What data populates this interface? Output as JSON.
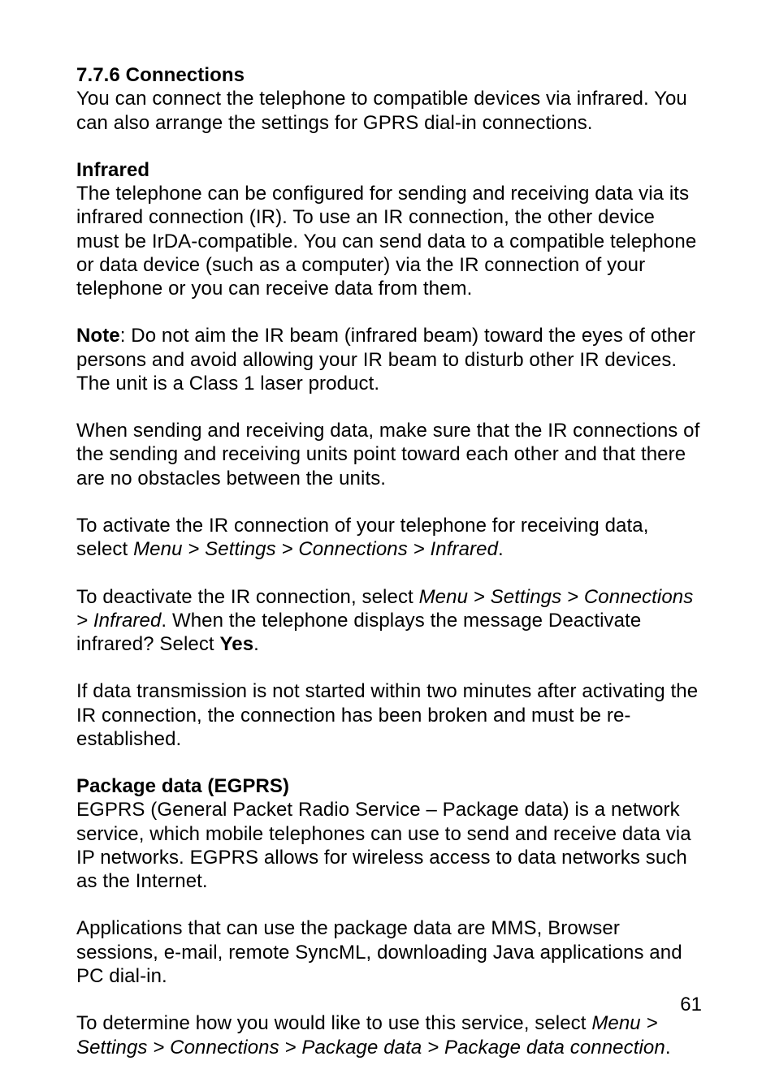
{
  "page_number": "61",
  "sec_num": "7.7.6 Connections",
  "sec_body": "You can connect the telephone to compatible devices via infrared. You can also arrange the settings for GPRS dial-in connections.",
  "infra_head": "Infrared",
  "infra_body": "The telephone can be configured for sending and receiving data via its infrared connection (IR). To use an IR connection, the other device must be IrDA-compatible. You can send data to a compatible telephone or data device (such as a computer) via the IR connection of your telephone or you can receive data from them.",
  "note_label": "Note",
  "note_body": ": Do not aim the IR beam (infrared beam) toward the eyes of other persons and avoid allowing your IR beam to disturb other IR devices. The unit is a Class 1 laser product.",
  "ir_align": "When sending and receiving data, make sure that the IR connections of the sending and receiving units point toward each other and that there are no obstacles between the units.",
  "activate_pre": "To activate the IR connection of your telephone for receiving data, select ",
  "activate_path": "Menu > Settings > Connections > Infrared",
  "activate_post": ".",
  "deact_pre": "To deactivate the IR connection, select ",
  "deact_path": "Menu > Settings > Connections > Infrared",
  "deact_mid": ". When the telephone displays the message Deactivate infrared? Select ",
  "deact_yes": "Yes",
  "deact_post": ".",
  "timeout": "If data transmission is not started within two minutes after activating the IR connection, the connection has been broken and must be re-established.",
  "egprs_head": "Package data (EGPRS)",
  "egprs_body": "EGPRS (General Packet Radio Service – Package data) is a network service, which mobile telephones can use to send and receive data via IP networks.  EGPRS allows for wireless access to data networks such as the Internet.",
  "apps": "Applications that can use the package data are MMS, Browser sessions, e-mail, remote SyncML, downloading Java applications and PC dial-in.",
  "svc_pre": "To determine how you would like to use this service, select ",
  "svc_path": "Menu > Settings > Connections > Package data > Package data connection",
  "svc_post": "."
}
